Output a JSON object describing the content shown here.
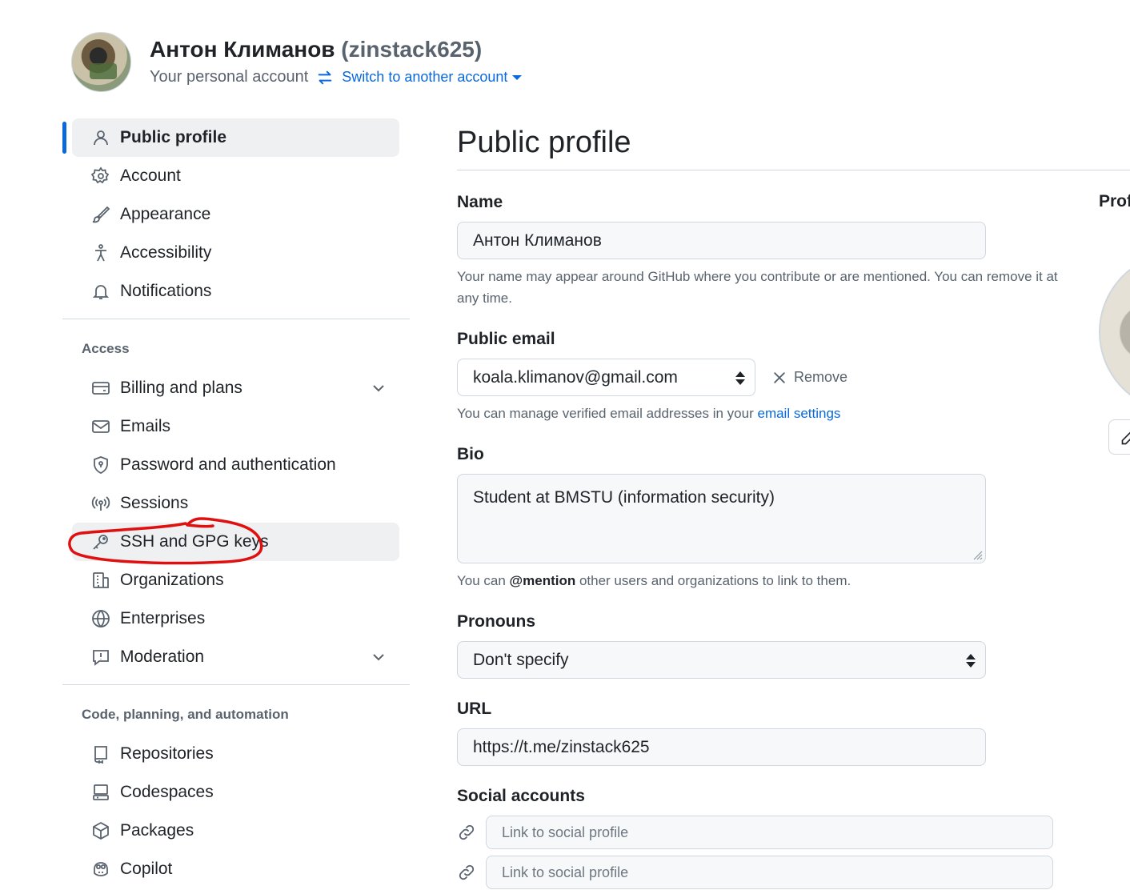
{
  "header": {
    "full_name": "Антон Климанов",
    "login": "(zinstack625)",
    "subtitle": "Your personal account",
    "switch_label": "Switch to another account"
  },
  "sidebar": {
    "items_top": [
      {
        "label": "Public profile",
        "icon": "person-icon",
        "active": true
      },
      {
        "label": "Account",
        "icon": "gear-icon"
      },
      {
        "label": "Appearance",
        "icon": "paintbrush-icon"
      },
      {
        "label": "Accessibility",
        "icon": "accessibility-icon"
      },
      {
        "label": "Notifications",
        "icon": "bell-icon"
      }
    ],
    "section_access": "Access",
    "items_access": [
      {
        "label": "Billing and plans",
        "icon": "credit-card-icon",
        "expandable": true
      },
      {
        "label": "Emails",
        "icon": "mail-icon"
      },
      {
        "label": "Password and authentication",
        "icon": "shield-lock-icon"
      },
      {
        "label": "Sessions",
        "icon": "broadcast-icon"
      },
      {
        "label": "SSH and GPG keys",
        "icon": "key-icon",
        "highlighted": true
      },
      {
        "label": "Organizations",
        "icon": "organization-icon"
      },
      {
        "label": "Enterprises",
        "icon": "globe-icon"
      },
      {
        "label": "Moderation",
        "icon": "report-icon",
        "expandable": true
      }
    ],
    "section_code": "Code, planning, and automation",
    "items_code": [
      {
        "label": "Repositories",
        "icon": "repo-icon"
      },
      {
        "label": "Codespaces",
        "icon": "codespaces-icon"
      },
      {
        "label": "Packages",
        "icon": "package-icon"
      },
      {
        "label": "Copilot",
        "icon": "copilot-icon"
      }
    ]
  },
  "main": {
    "title": "Public profile",
    "name": {
      "label": "Name",
      "value": "Антон Климанов",
      "note": "Your name may appear around GitHub where you contribute or are mentioned. You can remove it at any time."
    },
    "email": {
      "label": "Public email",
      "value": "koala.klimanov@gmail.com",
      "remove_label": "Remove",
      "note_prefix": "You can manage verified email addresses in your ",
      "note_link": "email settings"
    },
    "bio": {
      "label": "Bio",
      "value": "Student at BMSTU (information security)",
      "note_prefix": "You can ",
      "note_bold": "@mention",
      "note_suffix": " other users and organizations to link to them."
    },
    "pronouns": {
      "label": "Pronouns",
      "value": "Don't specify"
    },
    "url": {
      "label": "URL",
      "value": "https://t.me/zinstack625"
    },
    "social": {
      "label": "Social accounts",
      "placeholders": [
        "Link to social profile",
        "Link to social profile"
      ]
    }
  },
  "right": {
    "label": "Profile picture"
  },
  "colors": {
    "accent": "#0969da",
    "annotation": "#e01010",
    "active_bg": "#eef0f2"
  }
}
